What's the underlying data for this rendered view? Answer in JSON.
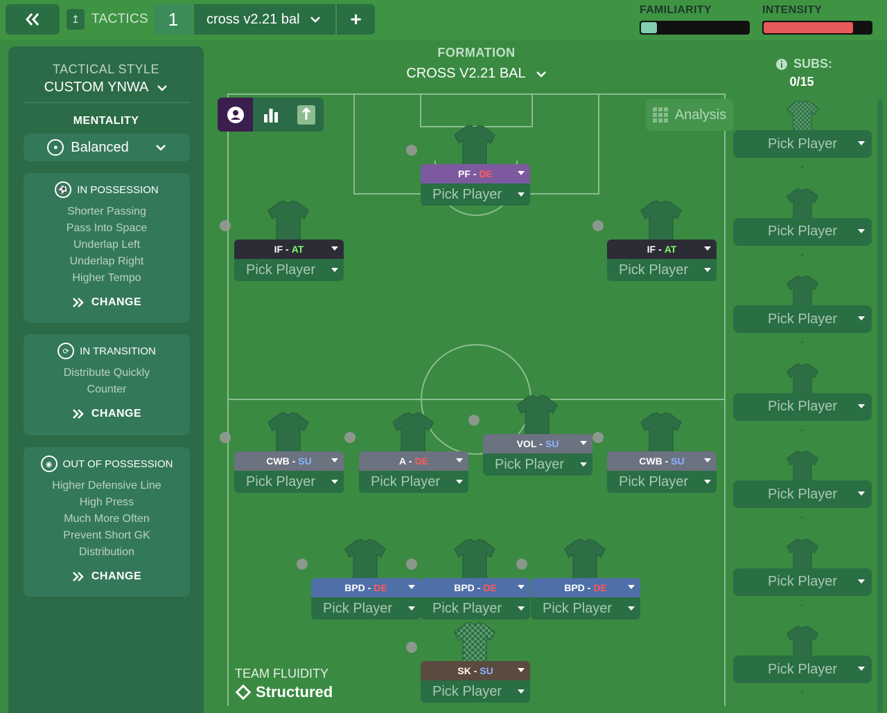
{
  "topbar": {
    "tactics_label": "TACTICS",
    "slot_number": "1",
    "tactic_name": "cross v2.21 bal",
    "familiarity_label": "FAMILIARITY",
    "intensity_label": "INTENSITY",
    "familiarity_level": 0.15,
    "intensity_level": 0.83
  },
  "left_panel": {
    "tactical_style_label": "TACTICAL STYLE",
    "tactical_style_value": "CUSTOM YNWA",
    "mentality_label": "MENTALITY",
    "mentality_value": "Balanced",
    "in_possession": {
      "title": "IN POSSESSION",
      "items": [
        "Shorter Passing",
        "Pass Into Space",
        "Underlap Left",
        "Underlap Right",
        "Higher Tempo"
      ],
      "change": "CHANGE"
    },
    "in_transition": {
      "title": "IN TRANSITION",
      "items": [
        "Distribute Quickly",
        "Counter"
      ],
      "change": "CHANGE"
    },
    "out_of_possession": {
      "title": "OUT OF POSSESSION",
      "items": [
        "Higher Defensive Line",
        "High Press",
        "Much More Often",
        "Prevent Short GK",
        "Distribution"
      ],
      "change": "CHANGE"
    }
  },
  "formation": {
    "label": "FORMATION",
    "value": "CROSS V2.21 BAL"
  },
  "analysis_label": "Analysis",
  "pick_label": "Pick Player",
  "players": [
    {
      "role": "PF",
      "duty": "DE",
      "color": "#7d5aa0"
    },
    {
      "role": "IF",
      "duty": "AT",
      "color": "#2c2c36"
    },
    {
      "role": "IF",
      "duty": "AT",
      "color": "#2c2c36"
    },
    {
      "role": "CWB",
      "duty": "SU",
      "color": "#6b7280"
    },
    {
      "role": "A",
      "duty": "DE",
      "color": "#6b7280"
    },
    {
      "role": "VOL",
      "duty": "SU",
      "color": "#6b7280"
    },
    {
      "role": "CWB",
      "duty": "SU",
      "color": "#6b7280"
    },
    {
      "role": "BPD",
      "duty": "DE",
      "color": "#4f6fa8"
    },
    {
      "role": "BPD",
      "duty": "DE",
      "color": "#4f6fa8"
    },
    {
      "role": "BPD",
      "duty": "DE",
      "color": "#4f6fa8"
    },
    {
      "role": "SK",
      "duty": "SU",
      "color": "#5b4a3e"
    }
  ],
  "duty_colors": {
    "DE": "#ff5a5a",
    "SU": "#8ab4ff",
    "AT": "#7dff6e"
  },
  "subs": {
    "label": "SUBS:",
    "count": "0/15",
    "slot_label": "Pick Player",
    "dash": "-"
  },
  "fluidity": {
    "label": "TEAM FLUIDITY",
    "value": "Structured"
  }
}
